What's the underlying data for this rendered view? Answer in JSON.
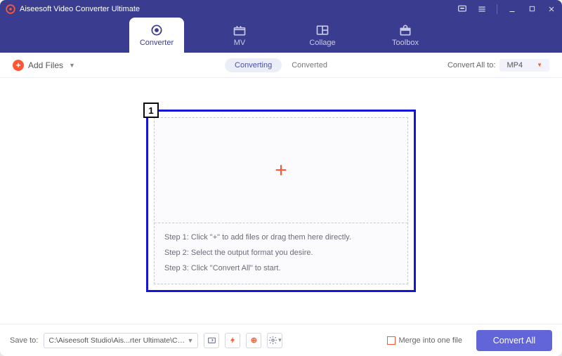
{
  "title": "Aiseesoft Video Converter Ultimate",
  "tabs": {
    "converter": "Converter",
    "mv": "MV",
    "collage": "Collage",
    "toolbox": "Toolbox"
  },
  "toolbar": {
    "add_files": "Add Files",
    "subtabs": {
      "converting": "Converting",
      "converted": "Converted"
    },
    "convert_all_to": "Convert All to:",
    "format": "MP4"
  },
  "annotation_number": "1",
  "steps": {
    "s1": "Step 1: Click \"+\" to add files or drag them here directly.",
    "s2": "Step 2: Select the output format you desire.",
    "s3": "Step 3: Click \"Convert All\" to start."
  },
  "bottom": {
    "save_to": "Save to:",
    "path": "C:\\Aiseesoft Studio\\Ais...rter Ultimate\\Converted",
    "merge": "Merge into one file",
    "convert_all": "Convert All"
  }
}
